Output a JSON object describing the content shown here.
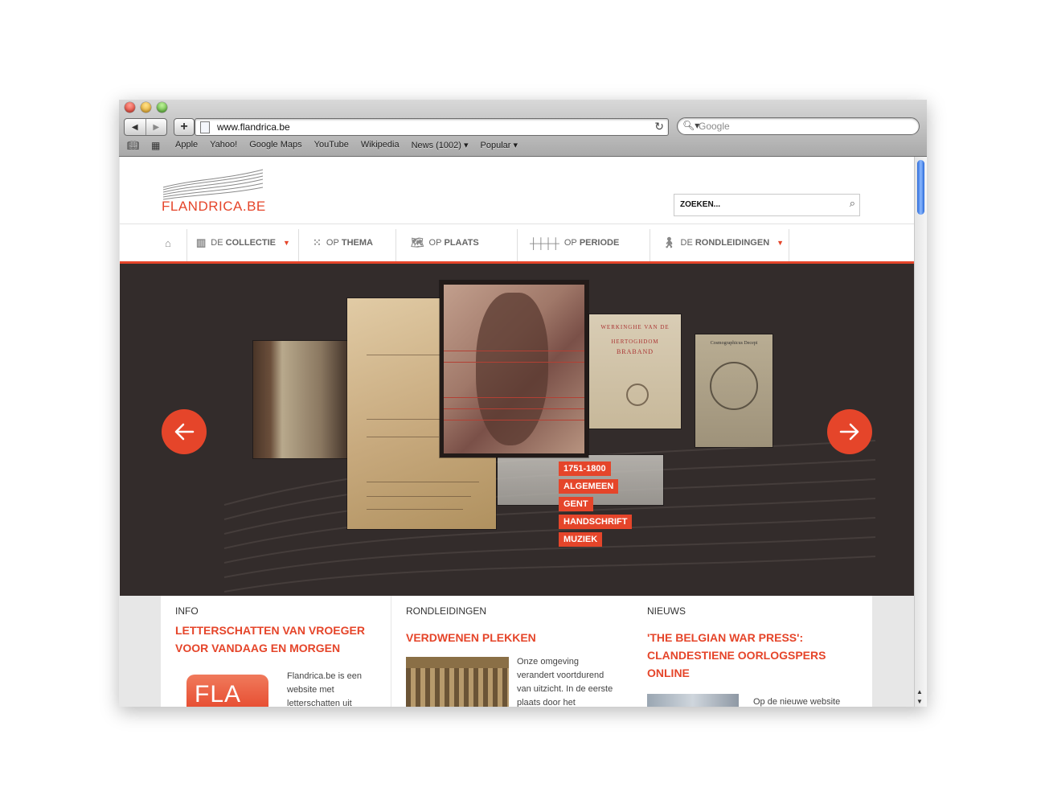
{
  "browser": {
    "url": "www.flandrica.be",
    "search_placeholder": "Google",
    "bookmarks": [
      "Apple",
      "Yahoo!",
      "Google Maps",
      "YouTube",
      "Wikipedia",
      "News (1002) ▾",
      "Popular ▾"
    ]
  },
  "site": {
    "logo_text": "FLANDRICA.BE",
    "search_placeholder": "ZOEKEN..."
  },
  "nav": {
    "collection_prefix": "DE",
    "collection": "COLLECTIE",
    "theme_prefix": "OP",
    "theme": "THEMA",
    "place_prefix": "OP",
    "place": "PLAATS",
    "period_prefix": "OP",
    "period": "PERIODE",
    "tours_prefix": "DE",
    "tours": "RONDLEIDINGEN"
  },
  "hero": {
    "tags": [
      "1751-1800",
      "ALGEMEEN",
      "GENT",
      "HANDSCHRIFT",
      "MUZIEK"
    ],
    "book_title_1": "WERKINGHE VAN DE",
    "book_title_2": "HERTOGHDOM",
    "book_title_3": "BRABAND",
    "globe_title": "Cosmographicus Decepi"
  },
  "bottom": {
    "info": {
      "label": "INFO",
      "heading_1": "LETTERSCHATTEN VAN VROEGER",
      "heading_2": "VOOR VANDAAG EN MORGEN",
      "logo_text": "FLA",
      "body": [
        "Flandrica.be is een",
        "website met",
        "letterschatten uit"
      ]
    },
    "tours": {
      "label": "RONDLEIDINGEN",
      "heading": "VERDWENEN PLEKKEN",
      "body": [
        "Onze omgeving",
        "verandert voortdurend",
        "van uitzicht. In de eerste",
        "plaats door het"
      ]
    },
    "news": {
      "label": "NIEUWS",
      "heading_1": "'THE BELGIAN WAR PRESS':",
      "heading_2": "CLANDESTIENE OORLOGSPERS",
      "heading_3": "ONLINE",
      "body": "Op de nieuwe website"
    }
  },
  "colors": {
    "accent": "#e5452a",
    "hero_bg": "#332c2b"
  }
}
